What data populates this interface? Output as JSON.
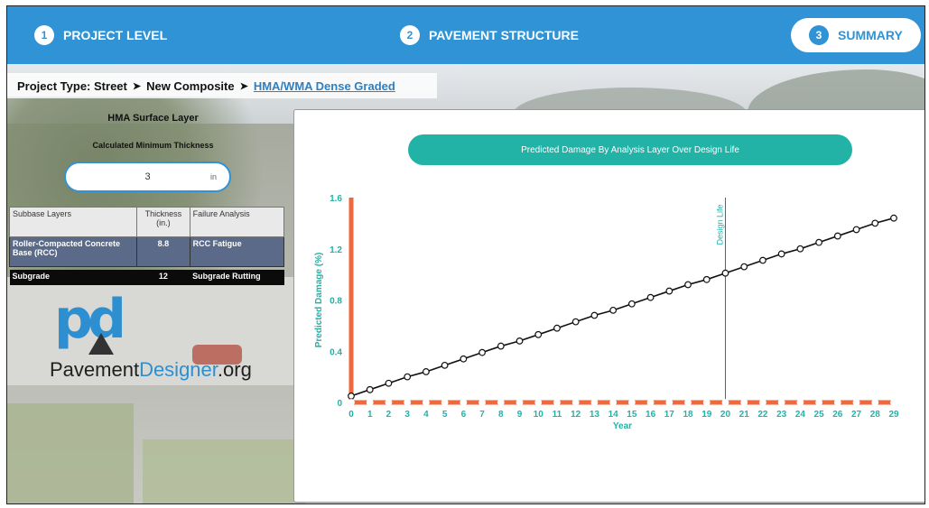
{
  "steps": [
    {
      "num": "1",
      "label": "PROJECT LEVEL"
    },
    {
      "num": "2",
      "label": "PAVEMENT STRUCTURE"
    },
    {
      "num": "3",
      "label": "SUMMARY"
    }
  ],
  "breadcrumb": {
    "prefix": "Project Type:",
    "item1": "Street",
    "item2": "New Composite",
    "link": "HMA/WMA Dense Graded",
    "separator_icon": "circle-arrow-right-icon"
  },
  "left_panel": {
    "heading": "HMA Surface Layer",
    "subheading": "Calculated Minimum Thickness",
    "thickness_value": "3",
    "thickness_unit": "in",
    "table": {
      "headers": [
        "Subbase Layers",
        "Thickness (in.)",
        "Failure Analysis"
      ],
      "rows": [
        {
          "layer": "Roller-Compacted Concrete Base (RCC)",
          "thickness": "8.8",
          "failure": "RCC Fatigue"
        },
        {
          "layer": "Subgrade",
          "thickness": "12",
          "failure": "Subgrade Rutting"
        }
      ]
    },
    "logo": {
      "mark": "pd",
      "text_dark": "Pavement",
      "text_blue": "Designer",
      "text_suffix": ".org"
    }
  },
  "colors": {
    "primary": "#2f93d5",
    "teal": "#22b2a6",
    "orange": "#ee6a3c",
    "rcc_row": "#5a6a88"
  },
  "chart_data": {
    "type": "line",
    "title": "Predicted Damage By Analysis Layer Over Design Life",
    "xlabel": "Year",
    "ylabel": "Predicted Damage (%)",
    "xlim": [
      0,
      29
    ],
    "ylim": [
      0,
      1.6
    ],
    "yticks": [
      "0",
      "0.4",
      "0.8",
      "1.2",
      "1.6"
    ],
    "x": [
      0,
      1,
      2,
      3,
      4,
      5,
      6,
      7,
      8,
      9,
      10,
      11,
      12,
      13,
      14,
      15,
      16,
      17,
      18,
      19,
      20,
      21,
      22,
      23,
      24,
      25,
      26,
      27,
      28,
      29
    ],
    "series": [
      {
        "values": [
          0.05,
          0.1,
          0.15,
          0.2,
          0.24,
          0.29,
          0.34,
          0.39,
          0.44,
          0.48,
          0.53,
          0.58,
          0.63,
          0.68,
          0.72,
          0.77,
          0.82,
          0.87,
          0.92,
          0.96,
          1.01,
          1.06,
          1.11,
          1.16,
          1.2,
          1.25,
          1.3,
          1.35,
          1.4,
          1.44
        ],
        "color": "#111111"
      },
      {
        "values": [
          0,
          0,
          0,
          0,
          0,
          0,
          0,
          0,
          0,
          0,
          0,
          0,
          0,
          0,
          0,
          0,
          0,
          0,
          0,
          0,
          0,
          0,
          0,
          0,
          0,
          0,
          0,
          0,
          0,
          0
        ],
        "color": "#ee6a3c"
      }
    ],
    "annotation": {
      "x": 20,
      "label": "Design Life"
    }
  }
}
